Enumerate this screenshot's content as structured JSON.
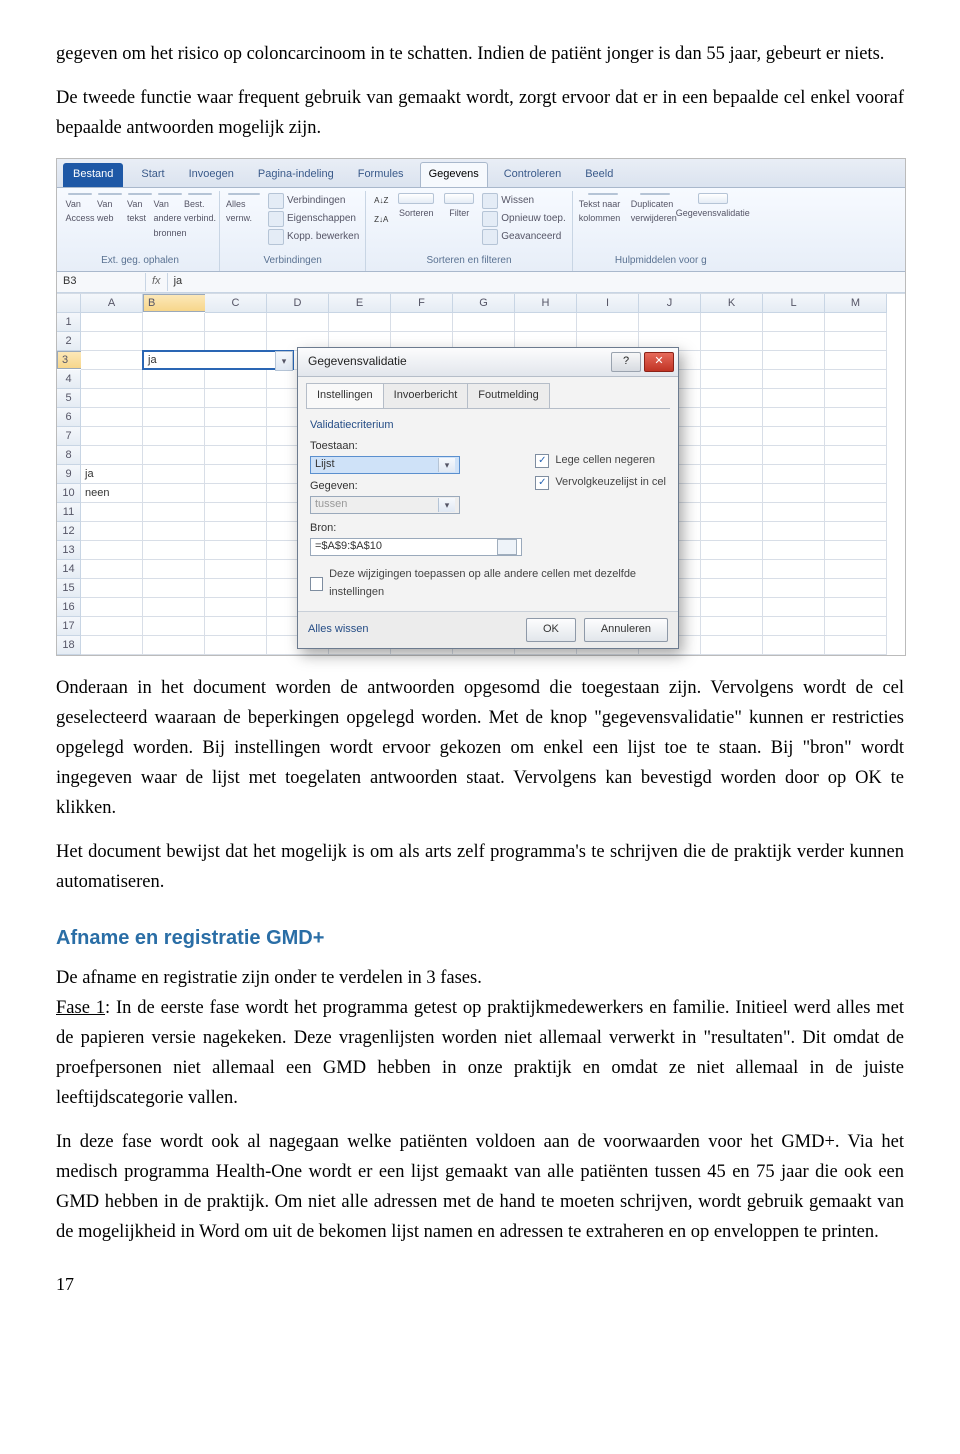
{
  "para1_a": "gegeven om het risico op coloncarcinoom in te schatten. Indien de patiënt jonger is dan 55 jaar, gebeurt er niets.",
  "para1_b": "De tweede functie waar frequent gebruik van gemaakt wordt, zorgt ervoor dat er in een bepaalde cel enkel vooraf bepaalde antwoorden mogelijk zijn.",
  "para2": "Onderaan in het document worden de antwoorden opgesomd die toegestaan zijn. Vervolgens wordt de cel geselecteerd waaraan de beperkingen opgelegd worden. Met de knop \"gegevensvalidatie\" kunnen er restricties opgelegd worden. Bij instellingen wordt ervoor gekozen om enkel een lijst toe te staan. Bij \"bron\" wordt ingegeven waar de lijst met toegelaten antwoorden staat. Vervolgens kan bevestigd worden door op OK te klikken.",
  "para3": "Het document bewijst dat het mogelijk is om als arts zelf programma's te schrijven die de praktijk verder kunnen automatiseren.",
  "heading": "Afname en registratie GMD+",
  "para4": "De afname en registratie zijn onder te verdelen in 3 fases.",
  "fase1_label": "Fase 1",
  "para5": ": In de eerste fase wordt het programma getest op praktijkmedewerkers en familie. Initieel werd alles met de papieren versie nagekeken. Deze vragenlijsten worden niet allemaal verwerkt in \"resultaten\". Dit omdat de proefpersonen niet allemaal een GMD hebben in onze praktijk en omdat ze niet allemaal in de juiste leeftijdscategorie vallen.",
  "para6": "In deze fase wordt ook al nagegaan welke patiënten voldoen aan de voorwaarden voor het GMD+. Via het medisch programma Health-One wordt er een lijst gemaakt van alle patiënten tussen 45 en 75 jaar die ook een GMD hebben in de praktijk. Om niet alle adressen met de hand te moeten schrijven, wordt gebruik gemaakt van de mogelijkheid in Word om uit de bekomen lijst namen en adressen te extraheren en op enveloppen te printen.",
  "pagenum": "17",
  "excel": {
    "tabs": {
      "bestand": "Bestand",
      "items": [
        "Start",
        "Invoegen",
        "Pagina-indeling",
        "Formules",
        "Gegevens",
        "Controleren",
        "Beeld"
      ],
      "active": "Gegevens"
    },
    "ribbon": {
      "g1": {
        "labels": [
          "Van Access",
          "Van web",
          "Van tekst",
          "Van andere bronnen",
          "Best. verbind."
        ],
        "group": "Ext. geg. ophalen"
      },
      "g2": {
        "label": "Alles vernw.",
        "lines": [
          "Verbindingen",
          "Eigenschappen",
          "Kopp. bewerken"
        ],
        "group": "Verbindingen"
      },
      "g3": {
        "icons": [
          "Sorteren",
          "Filter"
        ],
        "lines": [
          "Wissen",
          "Opnieuw toep.",
          "Geavanceerd"
        ],
        "sorticons": [
          "A↓Z",
          "Z↓A"
        ],
        "group": "Sorteren en filteren"
      },
      "g4": {
        "icons": [
          "Tekst naar kolommen",
          "Duplicaten verwijderen",
          "Gegevensvalidatie"
        ],
        "group": "Hulpmiddelen voor g"
      }
    },
    "namebox": "B3",
    "fx": "fx",
    "formula": "ja",
    "columns": [
      "A",
      "B",
      "C",
      "D",
      "E",
      "F",
      "G",
      "H",
      "I",
      "J",
      "K",
      "L",
      "M"
    ],
    "rows": 18,
    "cells": {
      "B3": "ja",
      "A9": "ja",
      "A10": "neen"
    },
    "dialog": {
      "title": "Gegevensvalidatie",
      "tabs": [
        "Instellingen",
        "Invoerbericht",
        "Foutmelding"
      ],
      "criterium": "Validatiecriterium",
      "toestaan_label": "Toestaan:",
      "toestaan_value": "Lijst",
      "gegeven_label": "Gegeven:",
      "gegeven_value": "tussen",
      "bron_label": "Bron:",
      "bron_value": "=$A$9:$A$10",
      "chk1": "Lege cellen negeren",
      "chk2": "Vervolgkeuzelijst in cel",
      "chk3": "Deze wijzigingen toepassen op alle andere cellen met dezelfde instellingen",
      "clear": "Alles wissen",
      "ok": "OK",
      "cancel": "Annuleren"
    }
  }
}
